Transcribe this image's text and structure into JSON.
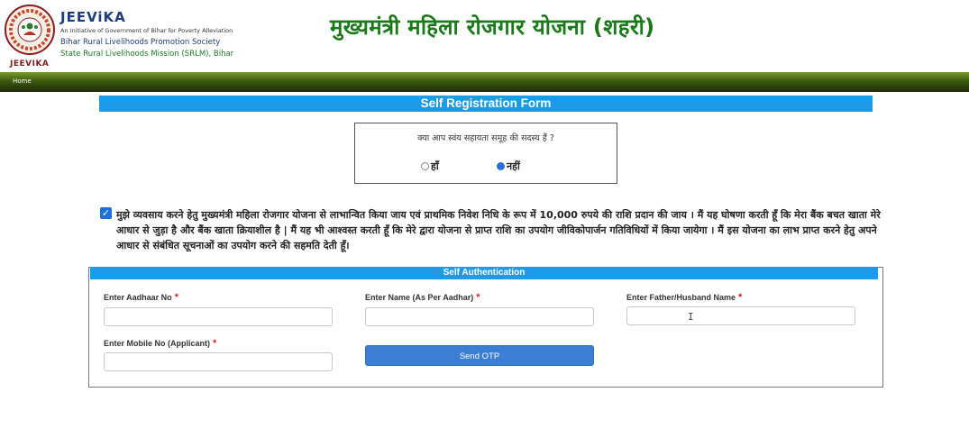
{
  "header": {
    "logo_caption": "JEEVIKA",
    "org_name": "JEEViKA",
    "tagline": "An Initiative of Government of Bihar for Poverty Alleviation",
    "society": "Bihar Rural Livelihoods Promotion Society",
    "mission": "State Rural Livelihoods Mission (SRLM), Bihar",
    "scheme_title": "मुख्यमंत्री महिला रोजगार योजना (शहरी)"
  },
  "nav": {
    "home": "Home"
  },
  "form": {
    "title": "Self Registration Form",
    "shg_question": "क्या आप स्वंय सहायता समूह की सदस्य हैं ?",
    "shg_options": [
      {
        "label": "हाँ",
        "selected": false
      },
      {
        "label": "नहीं",
        "selected": true
      }
    ],
    "consent_checked": true,
    "consent_text": "मुझे व्यवसाय करने हेतु मुख्यमंत्री महिला रोजगार योजना से लाभान्वित किया जाय एवं प्राथमिक निवेश निधि के रूप में 10,000 रुपये की राशि प्रदान की जाय । मैं यह घोषणा करती हूँ कि मेरा बैंक बचत खाता मेरे आधार से जुड़ा है और बैंक खाता क्रियाशील है | मैं यह भी आश्वस्त करती हूँ कि मेरे द्वारा योजना से प्राप्त राशि का उपयोग जीविकोपार्जन गतिविधियों में किया जायेगा । मैं इस योजना का लाभ प्राप्त करने हेतु अपने आधार से संबंधित सूचनाओं का उपयोग करने की सहमति देती हूँ।"
  },
  "auth": {
    "title": "Self Authentication",
    "aadhaar_label": "Enter Aadhaar No",
    "name_label": "Enter Name (As Per Aadhar)",
    "father_label": "Enter Father/Husband Name",
    "mobile_label": "Enter Mobile No (Applicant)",
    "required_mark": "*",
    "aadhaar_value": "",
    "name_value": "",
    "father_value": "",
    "mobile_value": "",
    "send_otp": "Send OTP"
  },
  "colors": {
    "banner_blue": "#1e9be6",
    "title_green": "#1a7a1a",
    "button_blue": "#3a7fd4",
    "required_red": "#e0201b"
  },
  "icons": [
    "jeevika-logo-icon",
    "checkbox-checked-icon",
    "text-cursor-icon"
  ]
}
